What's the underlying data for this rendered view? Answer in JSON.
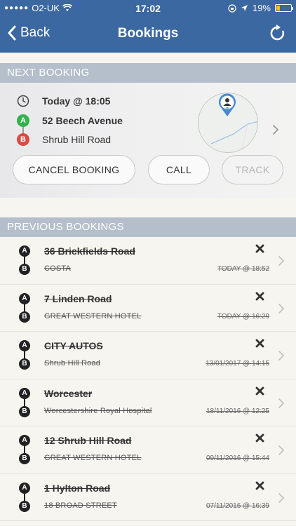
{
  "status_bar": {
    "carrier": "O2-UK",
    "time": "17:02",
    "battery": "19%",
    "battery_level": 0.19
  },
  "nav": {
    "back_label": "Back",
    "title": "Bookings"
  },
  "next_booking": {
    "header": "NEXT BOOKING",
    "time": "Today @ 18:05",
    "pickup": "52 Beech Avenue",
    "dropoff": "Shrub Hill Road",
    "pickup_marker": "A",
    "dropoff_marker": "B",
    "buttons": {
      "cancel": "CANCEL BOOKING",
      "call": "CALL",
      "track": "TRACK"
    }
  },
  "previous_bookings": {
    "header": "PREVIOUS BOOKINGS",
    "items": [
      {
        "from": "36 Brickfields Road",
        "to": "COSTA",
        "date": "TODAY @ 18:52"
      },
      {
        "from": "7 Linden Road",
        "to": "GREAT WESTERN HOTEL",
        "date": "TODAY @ 16:29"
      },
      {
        "from": "CITY AUTOS",
        "to": "Shrub Hill Road",
        "date": "13/01/2017 @ 14:15"
      },
      {
        "from": "Worcester",
        "to": "Worcestershire Royal Hospital",
        "date": "18/11/2016 @ 12:25"
      },
      {
        "from": "12 Shrub Hill Road",
        "to": "GREAT WESTERN HOTEL",
        "date": "09/11/2016 @ 15:44"
      },
      {
        "from": "1 Hylton Road",
        "to": "18 BROAD STREET",
        "date": "07/11/2016 @ 16:39"
      }
    ]
  },
  "colors": {
    "nav_bar": "#3b68a0",
    "section_header": "#b4bfcb",
    "pickup": "#33b24c",
    "dropoff": "#dc4a45",
    "battery": "#f5c400"
  },
  "icons": {
    "back": "chevron-left-icon",
    "refresh": "refresh-icon",
    "clock": "clock-icon",
    "map_pin": "driver-pin-icon",
    "cancelled": "x-icon",
    "row_chevron": "chevron-right-icon"
  }
}
